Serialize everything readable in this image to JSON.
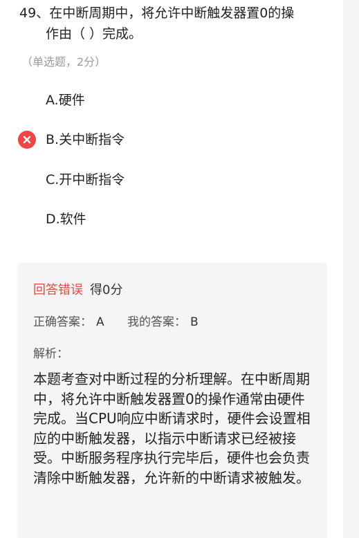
{
  "question": {
    "number": "49、",
    "line1": "在中断周期中，将允许中断触发器置0的操",
    "line2": "作由（ ）完成。"
  },
  "meta": "（单选题，2分）",
  "options": [
    {
      "label": "A.硬件",
      "selected_wrong": false
    },
    {
      "label": "B.关中断指令",
      "selected_wrong": true
    },
    {
      "label": "C.开中断指令",
      "selected_wrong": false
    },
    {
      "label": "D.软件",
      "selected_wrong": false
    }
  ],
  "icons": {
    "wrong": "close-icon"
  },
  "colors": {
    "wrong_red": "#f04545",
    "status_red": "#e8493f",
    "card_bg": "#f5f5f7"
  },
  "result": {
    "status": "回答错误",
    "score": "得0分",
    "correct_label": "正确答案：",
    "correct_value": "A",
    "mine_label": "我的答案：",
    "mine_value": "B"
  },
  "analysis": {
    "label": "解析：",
    "text": "本题考查对中断过程的分析理解。在中断周期中，将允许中断触发器置0的操作通常由硬件完成。当CPU响应中断请求时，硬件会设置相应的中断触发器，以指示中断请求已经被接受。中断服务程序执行完毕后，硬件也会负责清除中断触发器，允许新的中断请求被触发。"
  }
}
